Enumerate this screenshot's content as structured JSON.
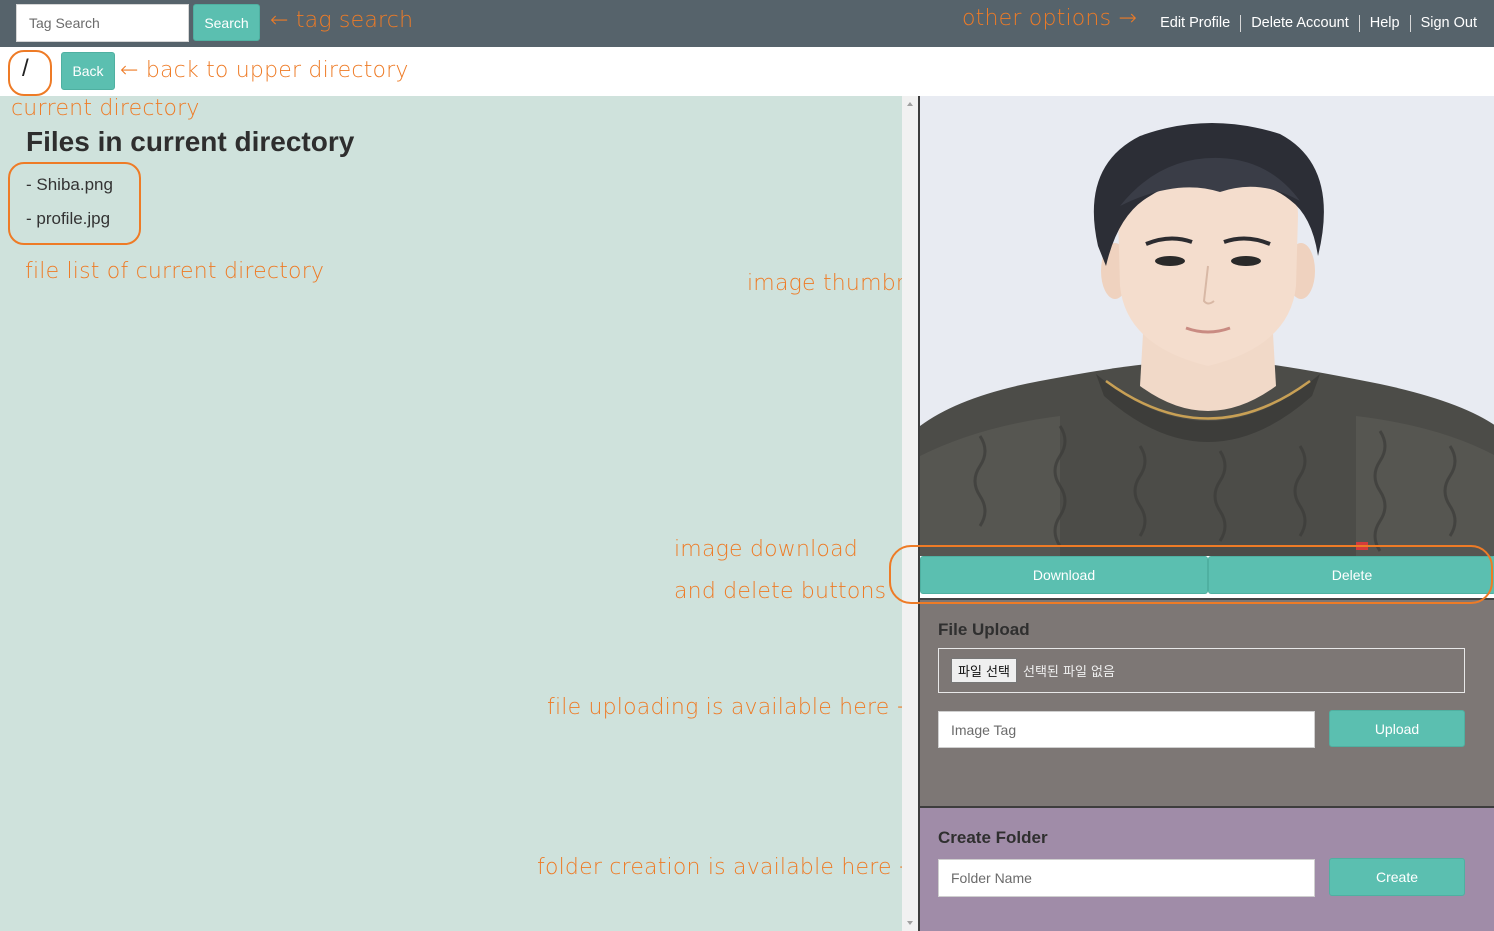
{
  "header": {
    "tag_search_placeholder": "Tag Search",
    "search_label": "Search",
    "nav": [
      "Edit Profile",
      "Delete Account",
      "Help",
      "Sign Out"
    ]
  },
  "directory": {
    "current": "/",
    "back_label": "Back"
  },
  "files": {
    "title": "Files in current directory",
    "items": [
      "- Shiba.png",
      "- profile.jpg"
    ]
  },
  "preview": {
    "download_label": "Download",
    "delete_label": "Delete"
  },
  "upload": {
    "title": "File Upload",
    "choose_label": "파일 선택",
    "no_file_label": "선택된 파일 없음",
    "tag_placeholder": "Image Tag",
    "upload_label": "Upload"
  },
  "folder": {
    "title": "Create Folder",
    "name_placeholder": "Folder Name",
    "create_label": "Create"
  },
  "annotations": {
    "tag_search": "← tag search",
    "other_options": "other options →",
    "back": "← back to upper directory",
    "current_directory": "current directory",
    "file_list": "file list of current directory",
    "thumbnail": "image thumbnail →",
    "download_delete_1": "image download",
    "download_delete_2": "and delete buttons",
    "upload": "file uploading is available here →",
    "folder": "folder creation is available here →"
  },
  "colors": {
    "accent": "#5bbfb0",
    "annotation": "#ee7b26",
    "topbar": "#56636b",
    "left_panel": "#cfe2dc",
    "upload_bg": "#7d7775",
    "folder_bg": "#a08ca8"
  }
}
